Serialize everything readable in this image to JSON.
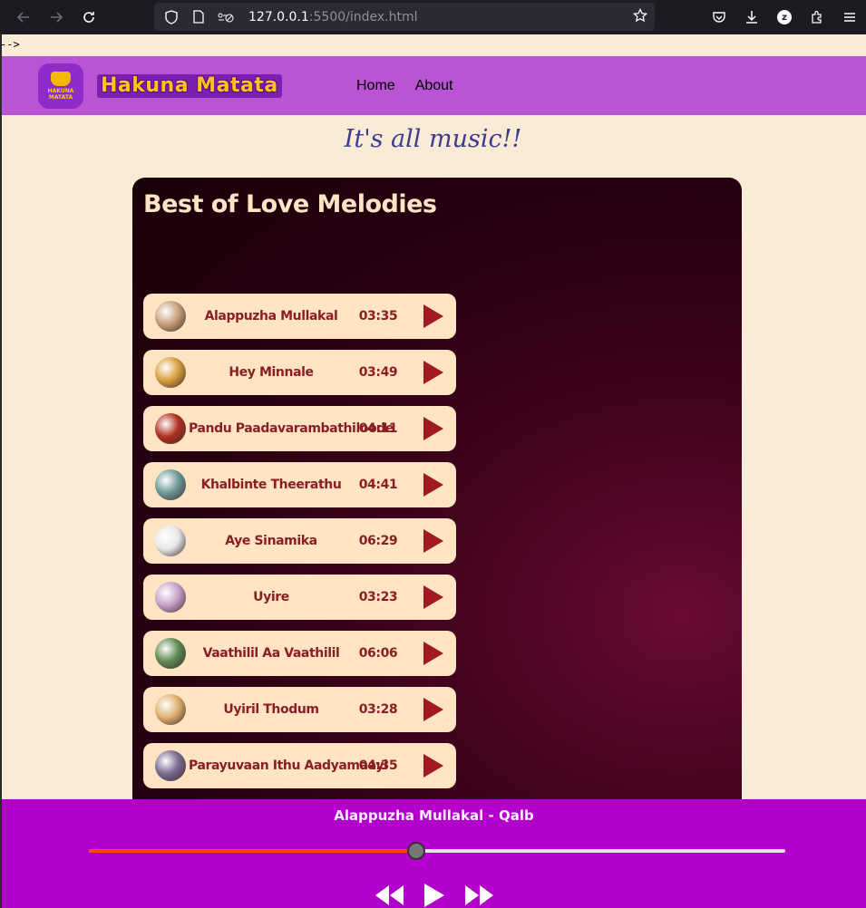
{
  "browser": {
    "url_host": "127.0.0.1",
    "url_rest": ":5500/index.html"
  },
  "stray_text": "-->",
  "header": {
    "logo_text": "HAKUNA MATATA",
    "brand": "Hakuna Matata",
    "nav": [
      "Home",
      "About"
    ]
  },
  "tagline": "It's all music!!",
  "playlist": {
    "title": "Best of Love Melodies",
    "tracks": [
      {
        "name": "Alappuzha Mullakal",
        "duration": "03:35",
        "thumb_color": "#c9a07a"
      },
      {
        "name": "Hey Minnale",
        "duration": "03:49",
        "thumb_color": "#d8a040"
      },
      {
        "name": "Pandu Paadavarambathiloode",
        "duration": "04:11",
        "thumb_color": "#b03020"
      },
      {
        "name": "Khalbinte Theerathu",
        "duration": "04:41",
        "thumb_color": "#6f9a98"
      },
      {
        "name": "Aye Sinamika",
        "duration": "06:29",
        "thumb_color": "#e8e8e8"
      },
      {
        "name": "Uyire",
        "duration": "03:23",
        "thumb_color": "#c7a2c9"
      },
      {
        "name": "Vaathilil Aa Vaathilil",
        "duration": "06:06",
        "thumb_color": "#5f8a55"
      },
      {
        "name": "Uyiril Thodum",
        "duration": "03:28",
        "thumb_color": "#e0b070"
      },
      {
        "name": "Parayuvaan Ithu Aadyamaayi",
        "duration": "04:35",
        "thumb_color": "#7a6a90"
      }
    ]
  },
  "player": {
    "now_playing": "Alappuzha Mullakal - Qalb",
    "progress": 0.47
  },
  "colors": {
    "header_bg": "#b955d4",
    "page_bg": "#faebd7",
    "track_bg": "#ffe4c4",
    "track_text": "#8b1e24",
    "player_bg": "#b400cc",
    "progress_fill": "#ff4500"
  }
}
